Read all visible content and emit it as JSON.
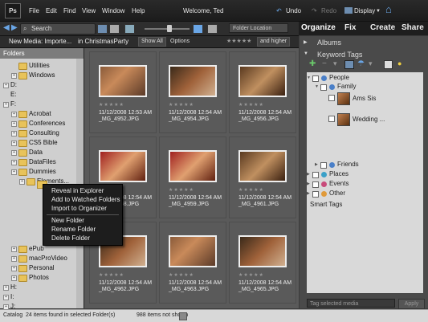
{
  "menubar": {
    "logo": "Ps",
    "items": [
      "File",
      "Edit",
      "Find",
      "View",
      "Window",
      "Help"
    ],
    "welcome": "Welcome, Ted",
    "undo": "Undo",
    "redo": "Redo",
    "display": "Display"
  },
  "searchbar": {
    "search_label": "Search",
    "folder_location": "Folder Location"
  },
  "tabs": [
    "Organize",
    "Fix",
    "Create",
    "Share"
  ],
  "filterbar": {
    "new_media": "New Media: Importe...",
    "in_text": "in ChristmasParty",
    "show_all": "Show All",
    "options": "Options",
    "rating_filter": "and higher"
  },
  "folders": {
    "title": "Folders",
    "tree": [
      {
        "label": "Utilities",
        "indent": 2,
        "plus": false,
        "folder": true
      },
      {
        "label": "Windows",
        "indent": 2,
        "plus": true,
        "folder": true
      },
      {
        "label": "D:",
        "indent": 1,
        "plus": true,
        "folder": false
      },
      {
        "label": "E:",
        "indent": 1,
        "plus": false,
        "folder": false
      },
      {
        "label": "F:",
        "indent": 1,
        "plus": true,
        "folder": false
      },
      {
        "label": "Acrobat",
        "indent": 2,
        "plus": true,
        "folder": true
      },
      {
        "label": "Conferences",
        "indent": 2,
        "plus": true,
        "folder": true
      },
      {
        "label": "Consulting",
        "indent": 2,
        "plus": true,
        "folder": true
      },
      {
        "label": "CS5 Bible",
        "indent": 2,
        "plus": true,
        "folder": true
      },
      {
        "label": "Data",
        "indent": 2,
        "plus": true,
        "folder": true
      },
      {
        "label": "DataFiles",
        "indent": 2,
        "plus": true,
        "folder": true
      },
      {
        "label": "Dummies",
        "indent": 2,
        "plus": true,
        "folder": true
      },
      {
        "label": "Elements...",
        "indent": 3,
        "plus": true,
        "folder": true
      }
    ],
    "tree_lower": [
      {
        "label": "ePub",
        "indent": 2,
        "plus": true,
        "folder": true
      },
      {
        "label": "macProVideo",
        "indent": 2,
        "plus": true,
        "folder": true
      },
      {
        "label": "Personal",
        "indent": 2,
        "plus": true,
        "folder": true
      },
      {
        "label": "Photos",
        "indent": 2,
        "plus": true,
        "folder": true
      },
      {
        "label": "H:",
        "indent": 1,
        "plus": true,
        "folder": false
      },
      {
        "label": "I:",
        "indent": 1,
        "plus": true,
        "folder": false
      },
      {
        "label": "J:",
        "indent": 1,
        "plus": true,
        "folder": false
      }
    ]
  },
  "context_menu": {
    "items": [
      "Reveal in Explorer",
      "Add to Watched Folders",
      "Import to Organizer"
    ],
    "items2": [
      "New Folder",
      "Rename Folder",
      "Delete Folder"
    ]
  },
  "grid": {
    "rating_stars": "★★★★★",
    "items": [
      {
        "date": "11/12/2008 12:53 AM",
        "file": "_MG_4952.JPG"
      },
      {
        "date": "11/12/2008 12:54 AM",
        "file": "_MG_4954.JPG"
      },
      {
        "date": "11/12/2008 12:54 AM",
        "file": "_MG_4956.JPG"
      },
      {
        "date": "11/12/2008 12:54 AM",
        "file": "_MG_4958.JPG"
      },
      {
        "date": "11/12/2008 12:54 AM",
        "file": "_MG_4959.JPG"
      },
      {
        "date": "11/12/2008 12:54 AM",
        "file": "_MG_4961.JPG"
      },
      {
        "date": "11/12/2008 12:54 AM",
        "file": "_MG_4962.JPG"
      },
      {
        "date": "11/12/2008 12:54 AM",
        "file": "_MG_4963.JPG"
      },
      {
        "date": "11/12/2008 12:54 AM",
        "file": "_MG_4965.JPG"
      }
    ]
  },
  "right_panel": {
    "albums": "Albums",
    "keyword_tags": "Keyword Tags",
    "tags": [
      {
        "label": "People",
        "indent": 0,
        "color": "#4a7fc8"
      },
      {
        "label": "Family",
        "indent": 1,
        "color": "#4a7fc8"
      },
      {
        "label": "Ams Sis",
        "indent": 2,
        "face": true
      },
      {
        "label": "Wedding ...",
        "indent": 2,
        "face": true
      },
      {
        "label": "Friends",
        "indent": 1,
        "color": "#4a7fc8"
      },
      {
        "label": "Places",
        "indent": 0,
        "color": "#3aa0c8"
      },
      {
        "label": "Events",
        "indent": 0,
        "color": "#c84a7a"
      },
      {
        "label": "Other",
        "indent": 0,
        "color": "#e09a3a"
      }
    ],
    "smart_tags": "Smart Tags",
    "tag_placeholder": "Tag selected media",
    "apply": "Apply"
  },
  "statusbar": {
    "catalog": "Catalog",
    "found": "24 items found in selected Folder(s)",
    "not_shown": "988 items not shown"
  }
}
